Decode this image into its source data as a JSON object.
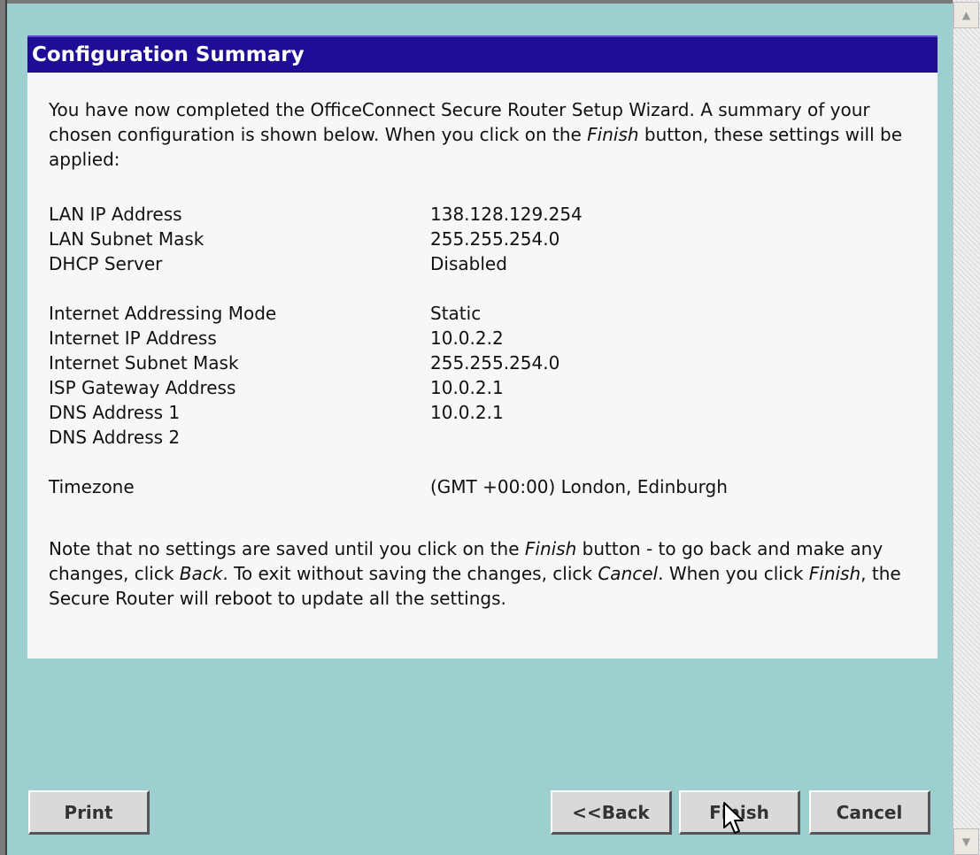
{
  "header": {
    "title": "Configuration Summary"
  },
  "intro": {
    "part1": "You have now completed the OfficeConnect Secure Router Setup Wizard. A summary of your chosen configuration is shown below. When you click on the ",
    "finish_word": "Finish",
    "part2": " button, these settings will be applied:"
  },
  "settings": {
    "lan": [
      {
        "label": "LAN IP Address",
        "value": "138.128.129.254"
      },
      {
        "label": "LAN Subnet Mask",
        "value": "255.255.254.0"
      },
      {
        "label": "DHCP Server",
        "value": "Disabled"
      }
    ],
    "internet": [
      {
        "label": "Internet Addressing Mode",
        "value": "Static"
      },
      {
        "label": "Internet IP Address",
        "value": "10.0.2.2"
      },
      {
        "label": "Internet Subnet Mask",
        "value": "255.255.254.0"
      },
      {
        "label": "ISP Gateway Address",
        "value": "10.0.2.1"
      },
      {
        "label": "DNS Address 1",
        "value": "10.0.2.1"
      },
      {
        "label": "DNS Address 2",
        "value": ""
      }
    ],
    "timezone": {
      "label": "Timezone",
      "value": "(GMT +00:00) London, Edinburgh"
    }
  },
  "note": {
    "t1": "Note that no settings are saved until you click on the ",
    "finish1": "Finish",
    "t2": " button - to go back and make any changes, click ",
    "back": "Back",
    "t3": ". To exit without saving the changes, click ",
    "cancel": "Cancel",
    "t4": ". When you click ",
    "finish2": "Finish",
    "t5": ", the Secure Router will reboot to update all the settings."
  },
  "buttons": {
    "print": "Print",
    "back": "<<Back",
    "finish": "Finish",
    "cancel": "Cancel"
  },
  "scrollbar": {
    "up_icon": "scroll-up-arrow-icon",
    "down_icon": "scroll-down-arrow-icon"
  },
  "colors": {
    "background": "#9dcfcf",
    "header_bg": "#1f0d96",
    "panel_bg": "#f7f7f7",
    "button_bg": "#d9d9d9"
  }
}
